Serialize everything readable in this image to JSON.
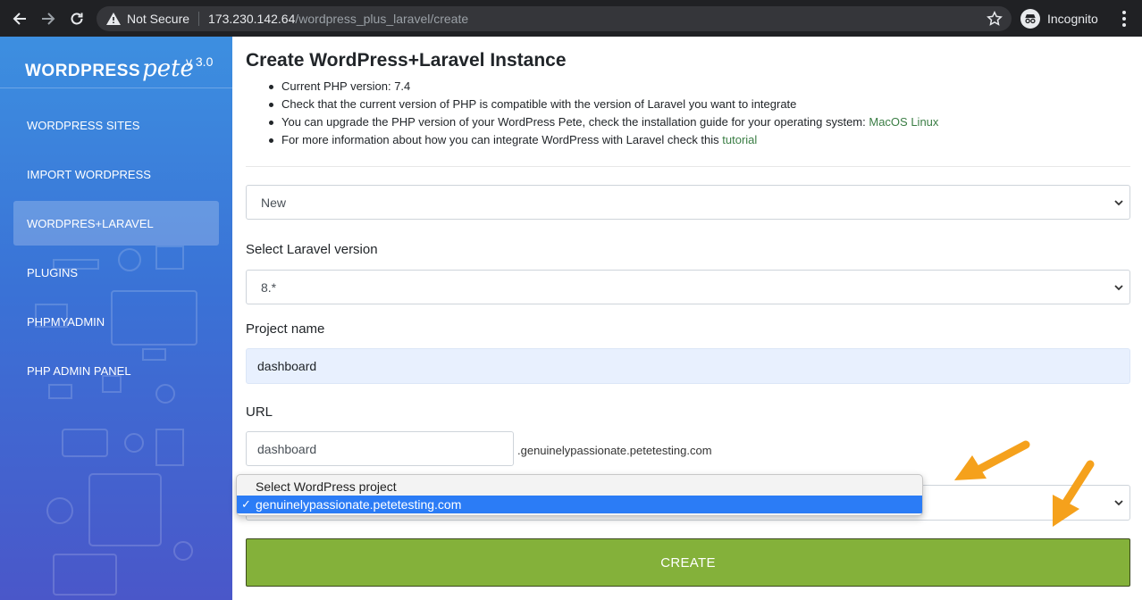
{
  "browser": {
    "security_label": "Not Secure",
    "url_host": "173.230.142.64",
    "url_path": "/wordpress_plus_laravel/create",
    "incognito_label": "Incognito"
  },
  "sidebar": {
    "brand_wordpress": "WORDPRESS",
    "brand_pete": "pete",
    "version": "v 3.0",
    "items": [
      {
        "label": "WORDPRESS SITES",
        "active": false
      },
      {
        "label": "IMPORT WORDPRESS",
        "active": false
      },
      {
        "label": "WORDPRES+LARAVEL",
        "active": true
      },
      {
        "label": "PLUGINS",
        "active": false
      },
      {
        "label": "PHPMYADMIN",
        "active": false
      },
      {
        "label": "PHP ADMIN PANEL",
        "active": false
      }
    ]
  },
  "main": {
    "title": "Create WordPress+Laravel Instance",
    "info": {
      "php_version": "Current PHP version: 7.4",
      "compat": "Check that the current version of PHP is compatible with the version of Laravel you want to integrate",
      "upgrade_prefix": "You can upgrade the PHP version of your WordPress Pete, check the installation guide for your operating system: ",
      "link_macos": "MacOS",
      "link_linux": "Linux",
      "more_prefix": "For more information about how you can integrate WordPress with Laravel check this ",
      "link_tutorial": "tutorial"
    },
    "mode_select": "New",
    "laravel_label": "Select Laravel version",
    "laravel_value": "8.*",
    "project_label": "Project name",
    "project_value": "dashboard",
    "url_label": "URL",
    "url_value": "dashboard",
    "url_suffix": ".genuinelypassionate.petetesting.com",
    "create_label": "CREATE"
  },
  "dropdown": {
    "options": [
      "Select WordPress project",
      "genuinelypassionate.petetesting.com"
    ],
    "selected": "genuinelypassionate.petetesting.com",
    "check": "✓"
  },
  "colors": {
    "accent_green": "#84b13a",
    "link_green": "#3a7d44",
    "highlight_blue": "#2b7cf6",
    "annotation_arrow": "#f5a11c"
  }
}
